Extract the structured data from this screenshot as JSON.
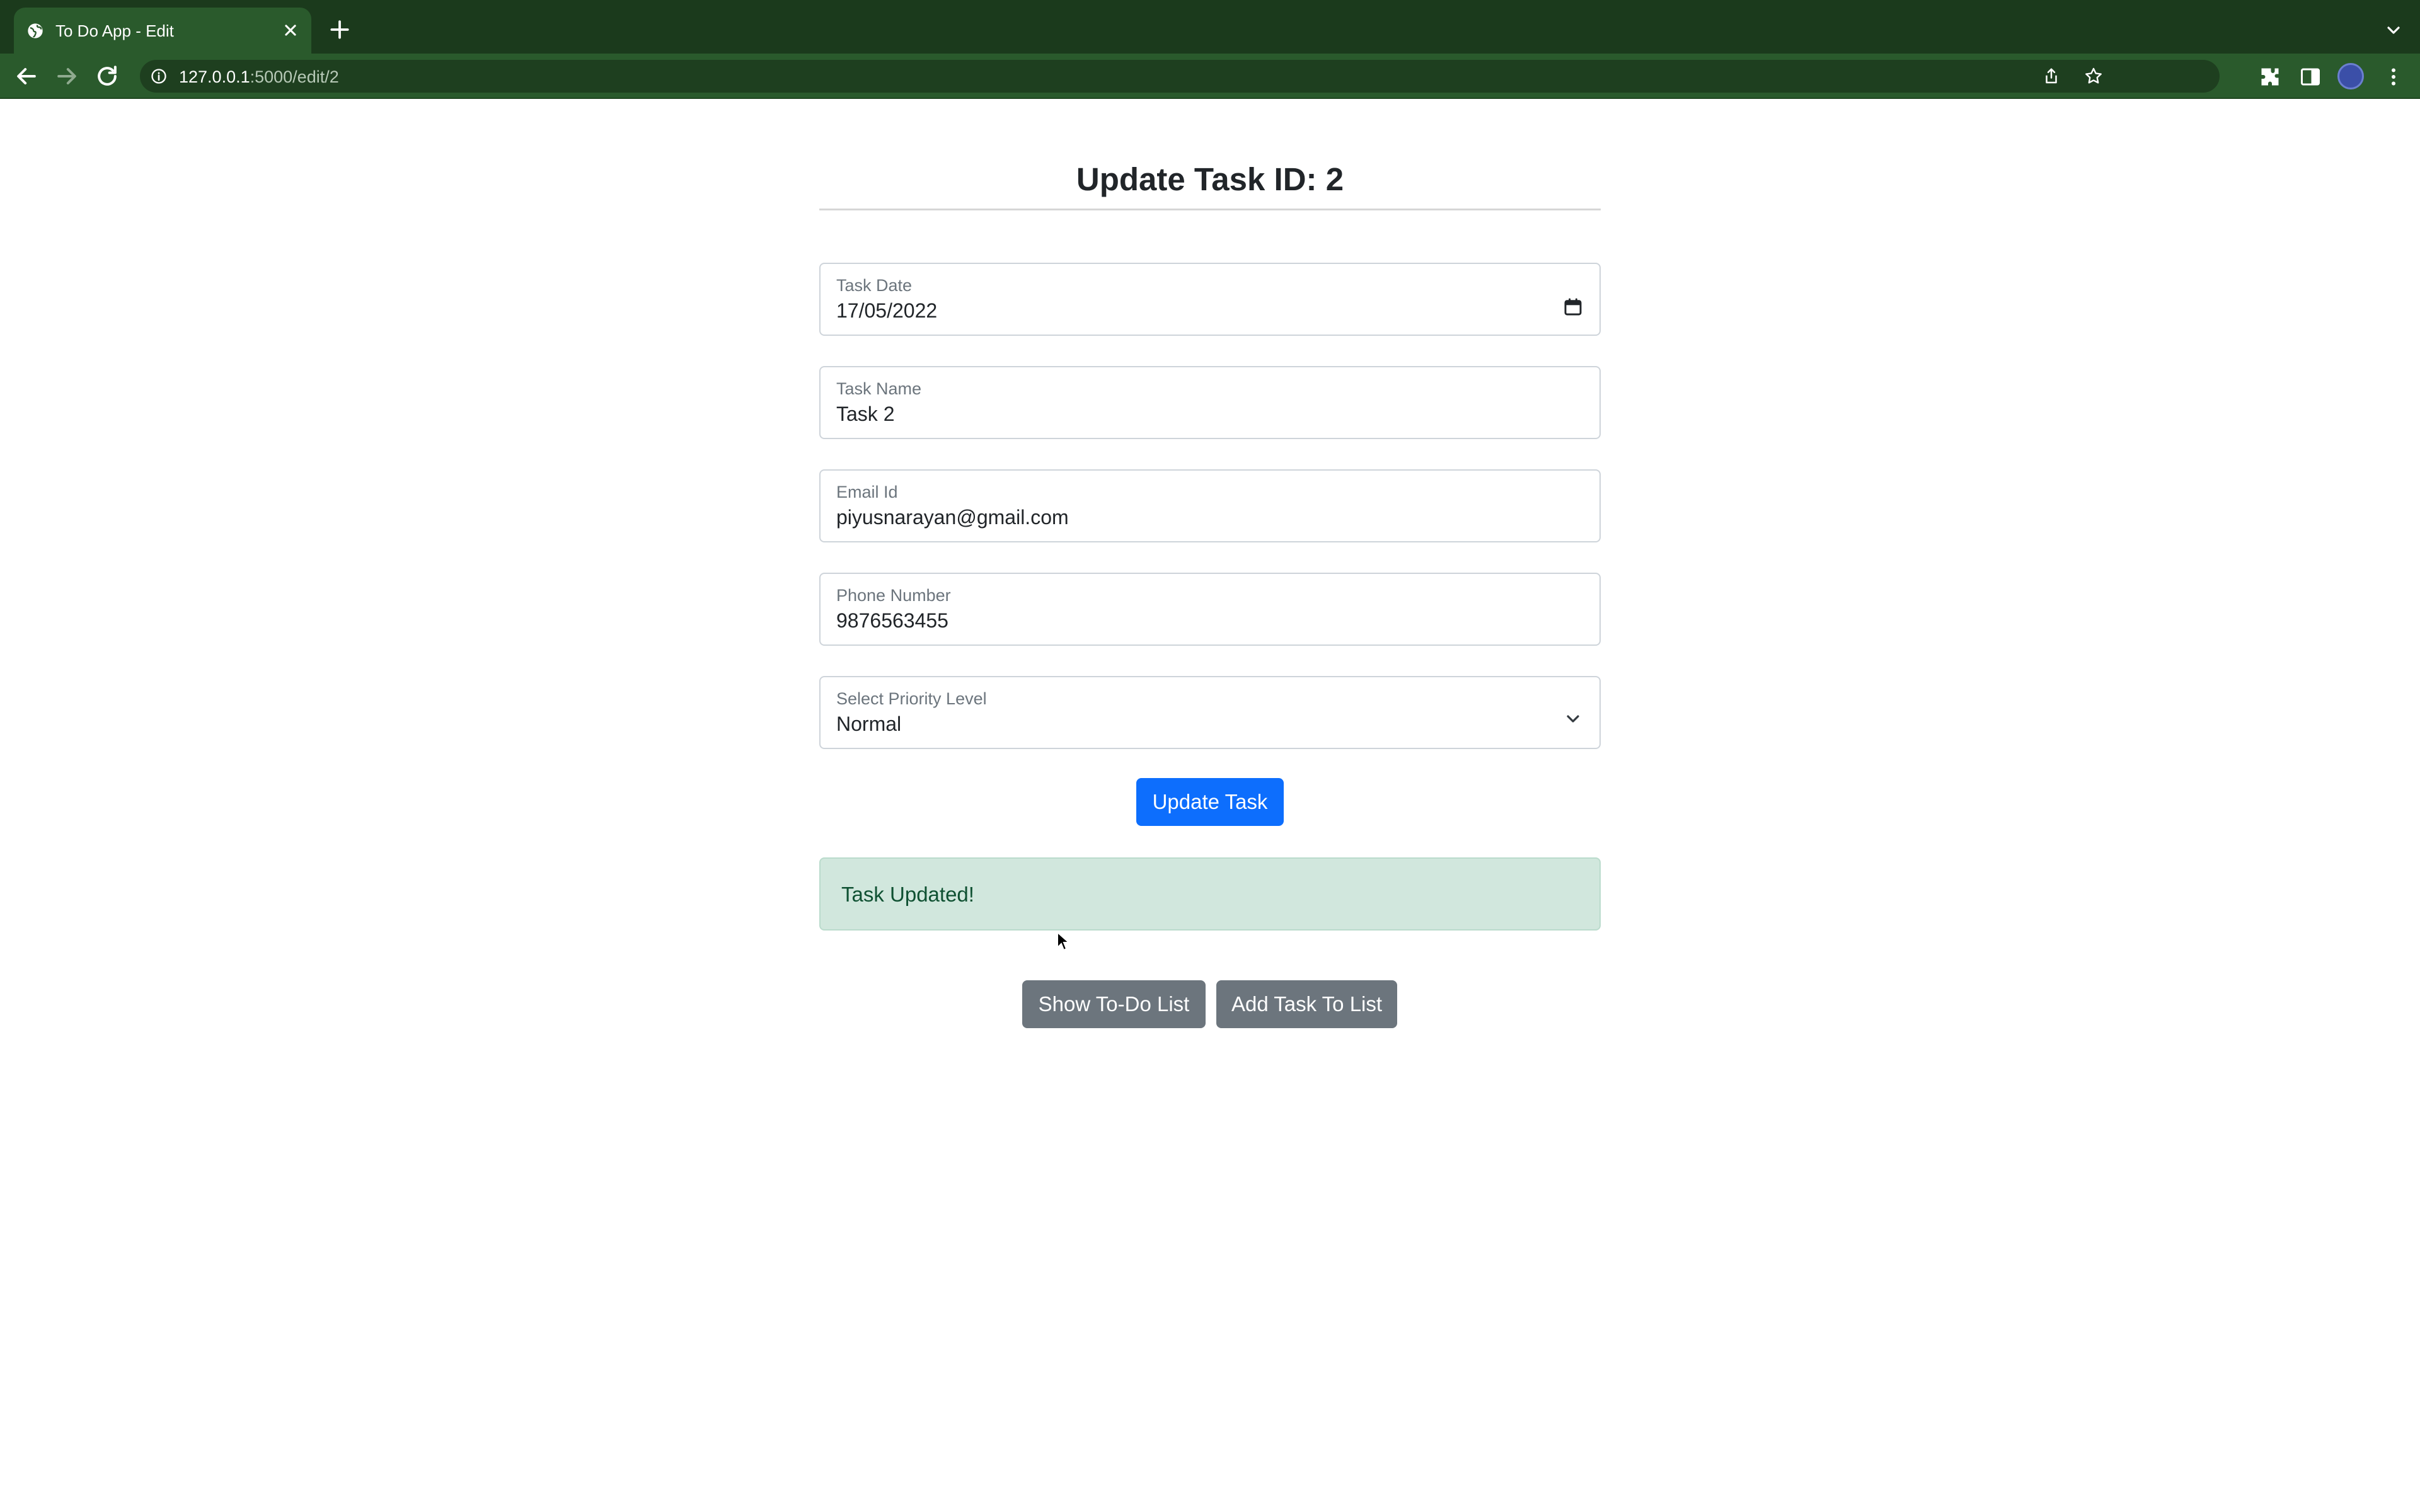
{
  "browser": {
    "tab_title": "To Do App - Edit",
    "url_host": "127.0.0.1",
    "url_path": ":5000/edit/2"
  },
  "page": {
    "title": "Update Task ID: 2"
  },
  "form": {
    "task_date": {
      "label": "Task Date",
      "value": "17/05/2022"
    },
    "task_name": {
      "label": "Task Name",
      "value": "Task 2"
    },
    "email": {
      "label": "Email Id",
      "value": "piyusnarayan@gmail.com"
    },
    "phone": {
      "label": "Phone Number",
      "value": "9876563455"
    },
    "priority": {
      "label": "Select Priority Level",
      "value": "Normal"
    },
    "submit_label": "Update Task"
  },
  "alert": {
    "message": "Task Updated!",
    "color": "#d1e7dd"
  },
  "actions": {
    "show_list_label": "Show To-Do List",
    "add_task_label": "Add Task To List"
  },
  "colors": {
    "primary": "#0d6efd",
    "secondary": "#6c757d",
    "browser_frame": "#2a5a2c"
  }
}
